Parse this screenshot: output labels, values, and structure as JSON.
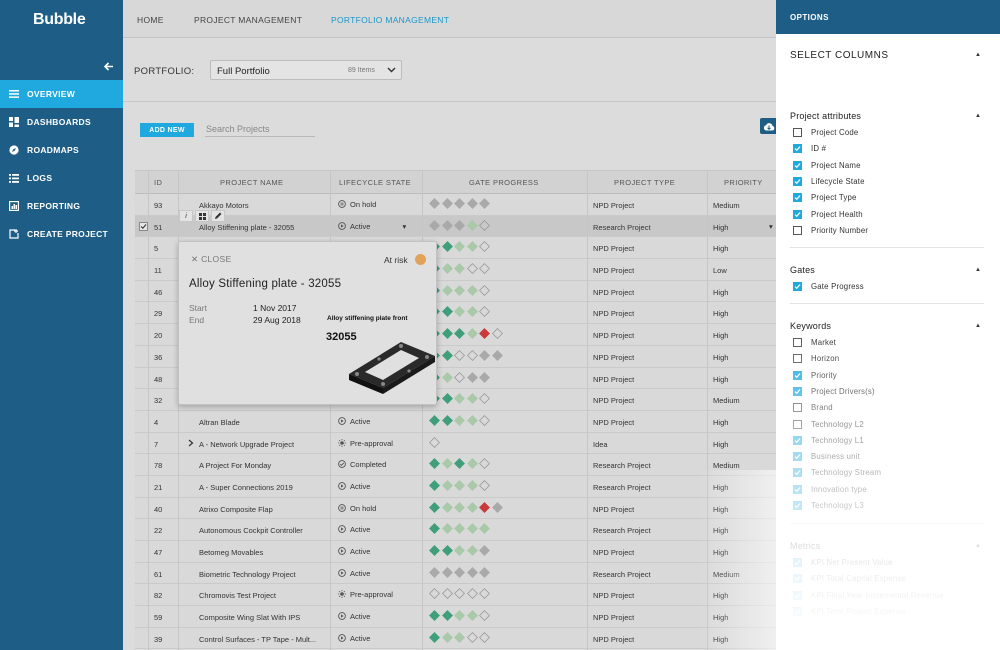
{
  "sidebar": {
    "brand": "Bubble",
    "items": [
      {
        "label": "OVERVIEW",
        "icon": "menu-icon",
        "active": true
      },
      {
        "label": "DASHBOARDS",
        "icon": "dashboard-icon"
      },
      {
        "label": "ROADMAPS",
        "icon": "compass-icon"
      },
      {
        "label": "LOGS",
        "icon": "list-icon"
      },
      {
        "label": "REPORTING",
        "icon": "report-icon"
      },
      {
        "label": "CREATE PROJECT",
        "icon": "create-icon"
      }
    ]
  },
  "topnav": {
    "home": "HOME",
    "project_management": "PROJECT MANAGEMENT",
    "portfolio_management": "PORTFOLIO MANAGEMENT"
  },
  "portfolio": {
    "label": "PORTFOLIO:",
    "value": "Full Portfolio",
    "count": "89 Items"
  },
  "actions": {
    "add_new": "ADD NEW",
    "search_placeholder": "Search Projects"
  },
  "table": {
    "headers": {
      "id": "ID",
      "name": "PROJECT NAME",
      "state": "LIFECYCLE STATE",
      "gate": "GATE PROGRESS",
      "type": "PROJECT TYPE",
      "priority": "PRIORITY"
    },
    "rows": [
      {
        "id": "93",
        "name": "Akkayo Motors",
        "state": "On hold",
        "type": "NPD Project",
        "priority": "Medium",
        "gates": "ggggg"
      },
      {
        "id": "51",
        "name": "Alloy Stiffening plate - 32055",
        "state": "Active",
        "type": "Research Project",
        "priority": "High",
        "gates": "ggglo"
      },
      {
        "id": "5",
        "name": "",
        "state": "",
        "type": "NPD Project",
        "priority": "High",
        "gates": "ddllo"
      },
      {
        "id": "11",
        "name": "",
        "state": "",
        "type": "NPD Project",
        "priority": "Low",
        "gates": "dlloo"
      },
      {
        "id": "46",
        "name": "",
        "state": "",
        "type": "NPD Project",
        "priority": "High",
        "gates": "dlllo"
      },
      {
        "id": "29",
        "name": "",
        "state": "",
        "type": "NPD Project",
        "priority": "High",
        "gates": "ddllo"
      },
      {
        "id": "20",
        "name": "",
        "state": "",
        "type": "NPD Project",
        "priority": "High",
        "gates": "dddlro"
      },
      {
        "id": "36",
        "name": "",
        "state": "",
        "type": "NPD Project",
        "priority": "High",
        "gates": "ddoogg"
      },
      {
        "id": "48",
        "name": "",
        "state": "",
        "type": "NPD Project",
        "priority": "High",
        "gates": "dlogg"
      },
      {
        "id": "32",
        "name": "",
        "state": "",
        "type": "NPD Project",
        "priority": "Medium",
        "gates": "ddllo"
      },
      {
        "id": "4",
        "name": "Altran Blade",
        "state": "Active",
        "type": "NPD Project",
        "priority": "High",
        "gates": "ddllo"
      },
      {
        "id": "7",
        "name": "A - Network Upgrade Project",
        "state": "Pre-approval",
        "type": "Idea",
        "priority": "High",
        "gates": "o",
        "expand": true
      },
      {
        "id": "78",
        "name": "A Project For Monday",
        "state": "Completed",
        "type": "Research Project",
        "priority": "Medium",
        "gates": "dldlo"
      },
      {
        "id": "21",
        "name": "A - Super Connections 2019",
        "state": "Active",
        "type": "Research Project",
        "priority": "High",
        "gates": "dlllo"
      },
      {
        "id": "40",
        "name": "Atrixo Composite Flap",
        "state": "On hold",
        "type": "NPD Project",
        "priority": "High",
        "gates": "dlllrg"
      },
      {
        "id": "22",
        "name": "Autonomous Cockpit Controller",
        "state": "Active",
        "type": "Research Project",
        "priority": "High",
        "gates": "dllll"
      },
      {
        "id": "47",
        "name": "Betomeg Movables",
        "state": "Active",
        "type": "NPD Project",
        "priority": "High",
        "gates": "ddllg"
      },
      {
        "id": "61",
        "name": "Biometric Technology Project",
        "state": "Active",
        "type": "Research Project",
        "priority": "Medium",
        "gates": "ggggg"
      },
      {
        "id": "82",
        "name": "Chromovis Test Project",
        "state": "Pre-approval",
        "type": "NPD Project",
        "priority": "High",
        "gates": "ooooo"
      },
      {
        "id": "59",
        "name": "Composite Wing Slat With IPS",
        "state": "Active",
        "type": "NPD Project",
        "priority": "High",
        "gates": "ddllo"
      },
      {
        "id": "39",
        "name": "Control Surfaces - TP Tape - Mult...",
        "state": "Active",
        "type": "NPD Project",
        "priority": "High",
        "gates": "dlloo"
      }
    ]
  },
  "popup": {
    "close": "CLOSE",
    "risk": "At risk",
    "title": "Alloy Stiffening plate - 32055",
    "start_label": "Start",
    "start_value": "1 Nov 2017",
    "end_label": "End",
    "end_value": "29 Aug 2018",
    "image_title": "Alloy stiffening plate front",
    "image_number": "32055"
  },
  "options": {
    "header": "OPTIONS",
    "subheader": "SELECT COLUMNS",
    "sections": [
      {
        "title": "Project attributes",
        "items": [
          {
            "label": "Project Code",
            "on": false
          },
          {
            "label": "ID #",
            "on": true
          },
          {
            "label": "Project Name",
            "on": true
          },
          {
            "label": "Lifecycle State",
            "on": true
          },
          {
            "label": "Project Type",
            "on": true
          },
          {
            "label": "Project Health",
            "on": true
          },
          {
            "label": "Priority Number",
            "on": false
          }
        ]
      },
      {
        "title": "Gates",
        "items": [
          {
            "label": "Gate Progress",
            "on": true
          }
        ]
      },
      {
        "title": "Keywords",
        "items": [
          {
            "label": "Market",
            "on": false
          },
          {
            "label": "Horizon",
            "on": false
          },
          {
            "label": "Priority",
            "on": true
          },
          {
            "label": "Project Drivers(s)",
            "on": true
          },
          {
            "label": "Brand",
            "on": false
          },
          {
            "label": "Technology L2",
            "on": false
          },
          {
            "label": "Technology L1",
            "on": true
          },
          {
            "label": "Business unit",
            "on": true
          },
          {
            "label": "Technology Stream",
            "on": true
          },
          {
            "label": "Innovation type",
            "on": true
          },
          {
            "label": "Technology L3",
            "on": true
          }
        ]
      },
      {
        "title": "Metrics",
        "items": [
          {
            "label": "KPI Net Present Value",
            "on": true
          },
          {
            "label": "KPI Total Capital Expense",
            "on": true
          },
          {
            "label": "KPI Final Year Incremental Revenue",
            "on": true
          },
          {
            "label": "KPI Total Project Expense",
            "on": true
          }
        ]
      }
    ]
  },
  "colors": {
    "sidebar": "#1d5d86",
    "accent": "#20a9df",
    "gate_dark": "#3f9f7a",
    "gate_light": "#a9c9a9",
    "gate_grey": "#a9a9a9",
    "gate_red": "#c9393d",
    "risk": "#e3a25a"
  }
}
